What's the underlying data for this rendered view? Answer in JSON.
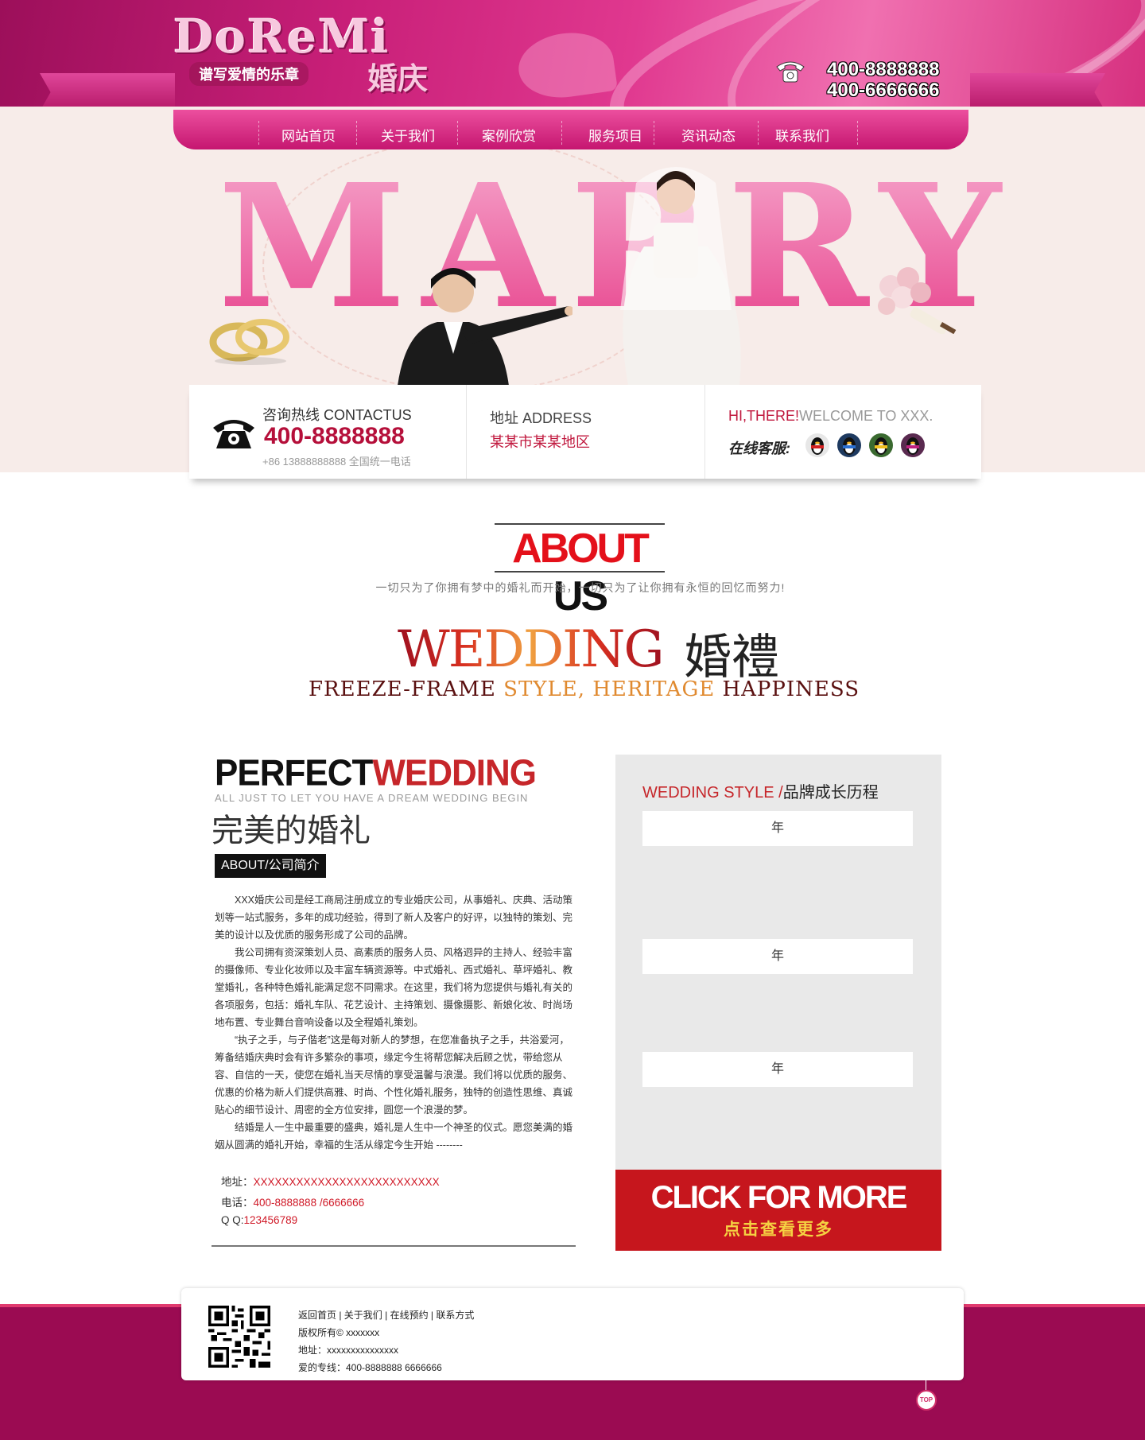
{
  "header": {
    "logo_text": "DoReMi",
    "logo_slogan": "谱写爱情的乐章",
    "logo_sub": "婚庆",
    "phone1": "400-8888888",
    "phone2": "400-6666666"
  },
  "nav": {
    "items": [
      {
        "label": "网站首页"
      },
      {
        "label": "关于我们"
      },
      {
        "label": "案例欣赏"
      },
      {
        "label": "服务项目"
      },
      {
        "label": "资讯动态"
      },
      {
        "label": "联系我们"
      }
    ]
  },
  "hero": {
    "title": "MARRY"
  },
  "contact_bar": {
    "hotline_label": "咨询热线 CONTACTUS",
    "hotline": "400-8888888",
    "hotline_note": "+86 13888888888 全国统一电话",
    "address_label": "地址 ADDRESS",
    "address_value": "某某市某某地区",
    "greeting_red": "HI,THERE!",
    "greeting_gray": "WELCOME TO XXX.",
    "online_service_label": "在线客服:"
  },
  "about": {
    "title_red": "ABOUT",
    "title_black": " US",
    "tagline": "一切只为了你拥有梦中的婚礼而开始，一切只为了让你拥有永恒的回忆而努力!",
    "wedding_en": "WEDDING",
    "wedding_cn": "婚禮",
    "freeze_1": "FREEZE-FRAME ",
    "freeze_2": "STYLE, HERITAGE",
    "freeze_3": " HAPPINESS"
  },
  "perfect": {
    "title_black": "PERFECT",
    "title_red": "WEDDING",
    "subtitle": "ALL JUST  TO LET YOU HAVE A DREAM WEDDING BEGIN",
    "title_cn": "完美的婚礼",
    "about_tag": "ABOUT/公司简介",
    "paragraphs": [
      "XXX婚庆公司是经工商局注册成立的专业婚庆公司，从事婚礼、庆典、活动策划等一站式服务，多年的成功经验，得到了新人及客户的好评，以独特的策划、完美的设计以及优质的服务形成了公司的品牌。",
      "我公司拥有资深策划人员、高素质的服务人员、风格迥异的主持人、经验丰富的摄像师、专业化妆师以及丰富车辆资源等。中式婚礼、西式婚礼、草坪婚礼、教堂婚礼，各种特色婚礼能满足您不同需求。在这里，我们将为您提供与婚礼有关的各项服务，包括：婚礼车队、花艺设计、主持策划、摄像摄影、新娘化妆、时尚场地布置、专业舞台音响设备以及全程婚礼策划。",
      "“执子之手，与子偕老”这是每对新人的梦想，在您准备执子之手，共浴爱河，筹备结婚庆典时会有许多繁杂的事项，缘定今生将帮您解决后顾之忧，带给您从容、自信的一天，使您在婚礼当天尽情的享受温馨与浪漫。我们将以优质的服务、优惠的价格为新人们提供高雅、时尚、个性化婚礼服务，独特的创造性思维、真诚贴心的细节设计、周密的全方位安排，圆您一个浪漫的梦。",
      "结婚是人一生中最重要的盛典，婚礼是人生中一个神圣的仪式。愿您美满的婚姻从圆满的婚礼开始，幸福的生活从缘定今生开始 --------"
    ],
    "address_label": "地址：",
    "address_value": "XXXXXXXXXXXXXXXXXXXXXXXXXX",
    "phone_label": "电话：",
    "phone_value": "400-8888888 /6666666",
    "qq_label": "Q  Q:",
    "qq_value": "123456789"
  },
  "style": {
    "title_red": "WEDDING STYLE /",
    "title_black": "品牌成长历程",
    "years": [
      "年",
      "年",
      "年"
    ],
    "click_en": "CLICK FOR MORE",
    "click_cn": "点击查看更多"
  },
  "footer": {
    "links": "返回首页 | 关于我们 | 在线预约 | 联系方式",
    "copyright": "版权所有©  xxxxxxx",
    "address": "地址：xxxxxxxxxxxxxxx",
    "hotline": "爱的专线：400-8888888 6666666",
    "top_label": "TOP"
  },
  "colors": {
    "brand_pink": "#c81f78",
    "accent_red": "#c6262a",
    "footer_bg": "#9b0b52"
  }
}
